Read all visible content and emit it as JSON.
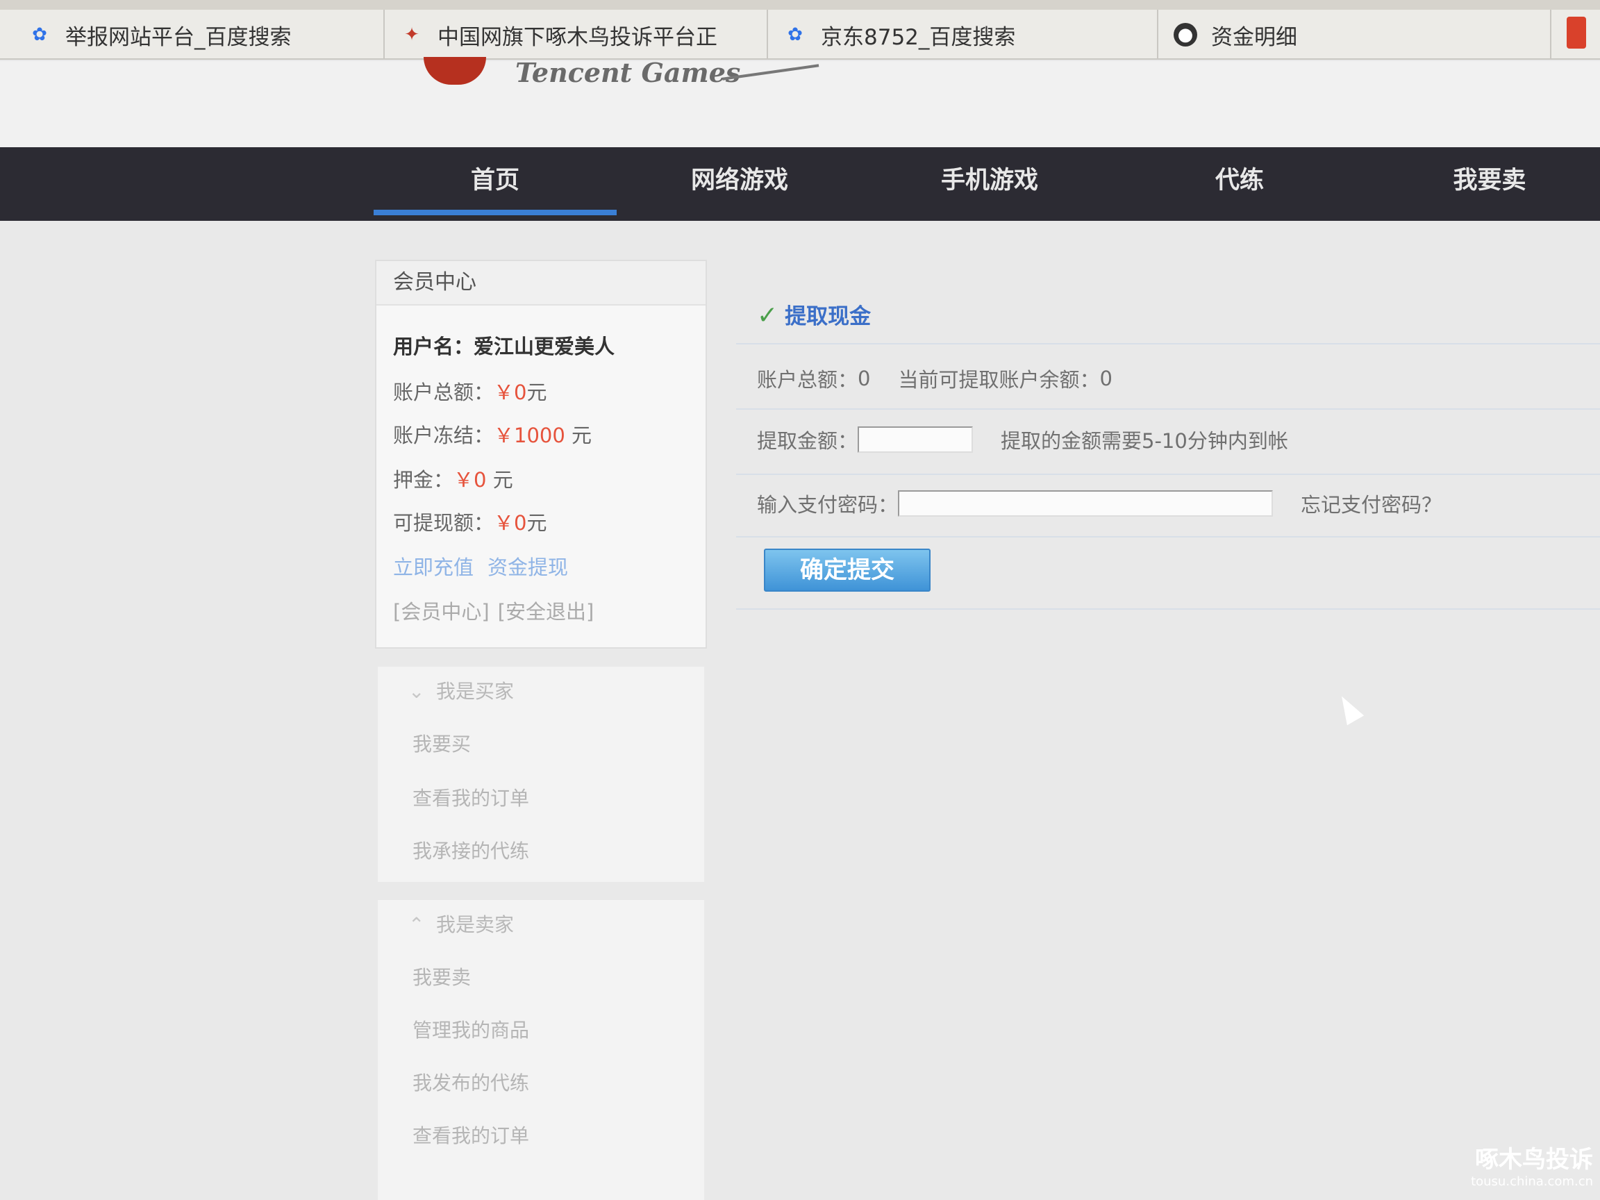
{
  "browser": {
    "tabs": [
      {
        "label": "举报网站平台_百度搜索",
        "icon": "paw-icon"
      },
      {
        "label": "中国网旗下啄木鸟投诉平台正",
        "icon": "bird-icon"
      },
      {
        "label": "京东8752_百度搜索",
        "icon": "paw-icon"
      },
      {
        "label": "资金明细",
        "icon": "site-icon"
      }
    ]
  },
  "header": {
    "logo_text": "Tencent Games"
  },
  "nav": {
    "items": [
      "首页",
      "网络游戏",
      "手机游戏",
      "代练",
      "我要卖"
    ],
    "active_index": 0,
    "accent_color": "#3a7fd6"
  },
  "member": {
    "title": "会员中心",
    "username_label": "用户名：",
    "username": "爱江山更爱美人",
    "total_label": "账户总额：",
    "total_value": "￥0",
    "total_unit": "元",
    "frozen_label": "账户冻结：",
    "frozen_value": "￥1000",
    "frozen_unit": "元",
    "deposit_label": "押金：",
    "deposit_value": "￥0",
    "deposit_unit": "元",
    "withdrawable_label": "可提现额：",
    "withdrawable_value": "￥0",
    "withdrawable_unit": "元",
    "recharge_link": "立即充值",
    "withdraw_link": "资金提现",
    "center_link": "[会员中心]",
    "logout_link": "[安全退出]"
  },
  "buyer_menu": {
    "title": "我是买家",
    "items": [
      "我要买",
      "查看我的订单",
      "我承接的代练"
    ]
  },
  "seller_menu": {
    "title": "我是卖家",
    "items": [
      "我要卖",
      "管理我的商品",
      "我发布的代练",
      "查看我的订单"
    ]
  },
  "withdraw": {
    "title": "提取现金",
    "total_label": "账户总额：",
    "total_value": "0",
    "available_label": "当前可提取账户余额：",
    "available_value": "0",
    "amount_label": "提取金额：",
    "amount_value": "",
    "amount_note": "提取的金额需要5-10分钟内到帐",
    "password_label": "输入支付密码：",
    "password_value": "",
    "forgot_link": "忘记支付密码？",
    "submit_label": "确定提交"
  },
  "watermark": {
    "line1": "啄木鸟投诉",
    "line2": "tousu.china.com.cn"
  }
}
